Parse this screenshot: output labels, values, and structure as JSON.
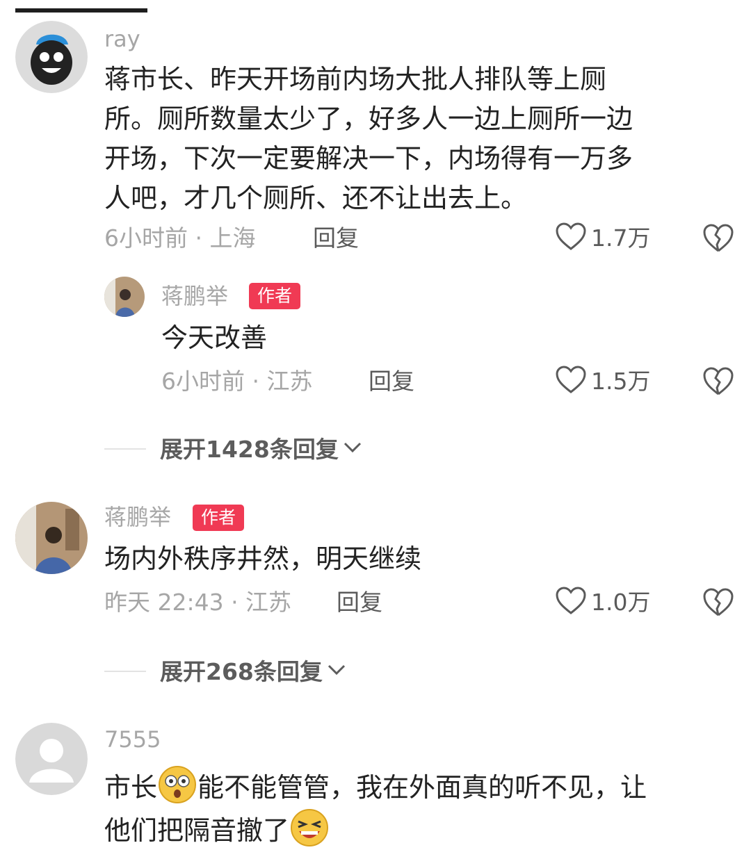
{
  "comments": [
    {
      "user": "ray",
      "lines": [
        "蒋市长、昨天开场前内场大批人排队等上厕",
        "所。厕所数量太少了，好多人一边上厕所一边",
        "开场，下次一定要解决一下，内场得有一万多",
        "人吧，才几个厕所、还不让出去上。"
      ],
      "meta": "6小时前 · 上海",
      "reply_label": "回复",
      "likes": "1.7万",
      "sub_reply": {
        "user": "蒋鹏举",
        "badge": "作者",
        "text": "今天改善",
        "meta": "6小时前 · 江苏",
        "reply_label": "回复",
        "likes": "1.5万"
      },
      "expand_label": "展开1428条回复"
    },
    {
      "user": "蒋鹏举",
      "badge": "作者",
      "text": "场内外秩序井然，明天继续",
      "meta": "昨天 22:43 · 江苏",
      "reply_label": "回复",
      "likes": "1.0万",
      "expand_label": "展开268条回复"
    },
    {
      "user": "7555",
      "line1_part1": "市长",
      "line1_part2": "能不能管管，我在外面真的听不见，让",
      "line2": "他们把隔音撤了",
      "emoji1": "shocked-emoji",
      "emoji2": "laughing-emoji"
    }
  ],
  "colors": {
    "author_badge": "#f03a54",
    "meta_gray": "#a6a6a6",
    "text": "#222222"
  }
}
